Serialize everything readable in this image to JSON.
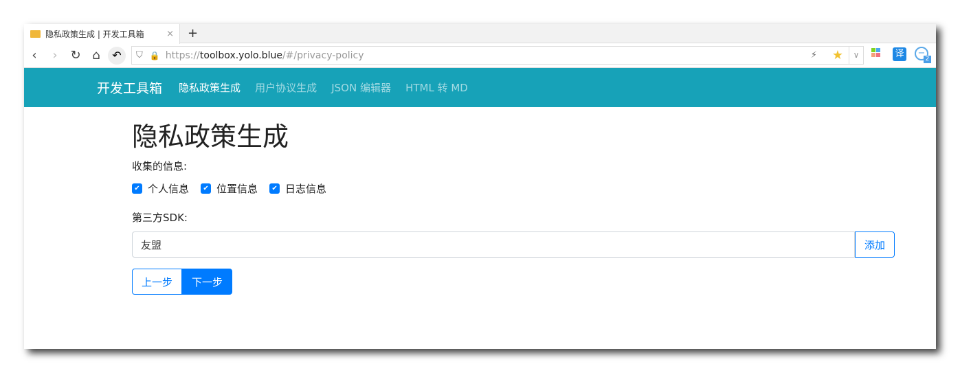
{
  "browser": {
    "tab_title": "隐私政策生成 | 开发工具箱",
    "close": "×",
    "new_tab": "+",
    "url_scheme": "https://",
    "url_host": "toolbox.yolo.blue",
    "url_path": "/#/privacy-policy",
    "translate_badge": "译",
    "ext_count": "2"
  },
  "navbar": {
    "brand": "开发工具箱",
    "links": [
      {
        "label": "隐私政策生成"
      },
      {
        "label": "用户协议生成"
      },
      {
        "label": "JSON 编辑器"
      },
      {
        "label": "HTML 转 MD"
      }
    ]
  },
  "main": {
    "title": "隐私政策生成",
    "collected_label": "收集的信息:",
    "checks": [
      {
        "label": "个人信息",
        "checked": true
      },
      {
        "label": "位置信息",
        "checked": true
      },
      {
        "label": "日志信息",
        "checked": true
      }
    ],
    "sdk_label": "第三方SDK:",
    "sdk_value": "友盟",
    "add": "添加",
    "prev": "上一步",
    "next": "下一步"
  }
}
